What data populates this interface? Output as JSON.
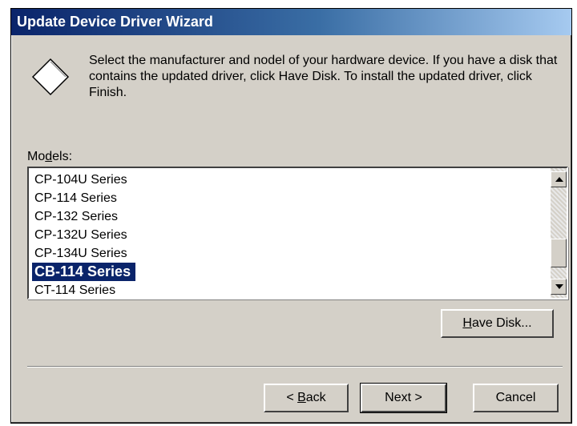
{
  "window": {
    "title": "Update Device Driver Wizard"
  },
  "instructions": "Select the manufacturer and nodel of your hardware device. If you have a disk that contains the updated driver, click Have Disk. To install the updated driver, click Finish.",
  "models": {
    "label_prefix": "Mo",
    "label_accel": "d",
    "label_suffix": "els:",
    "items": [
      "CP-104U Series",
      "CP-114 Series",
      "CP-132 Series",
      "CP-132U Series",
      "CP-134U Series",
      "CB-114 Series",
      "CT-114 Series"
    ],
    "selected": "CB-114 Series"
  },
  "buttons": {
    "have_disk_accel": "H",
    "have_disk_rest": "ave Disk...",
    "back_prefix": "< ",
    "back_accel": "B",
    "back_rest": "ack",
    "next": "Next >",
    "cancel": "Cancel"
  },
  "colors": {
    "title_start": "#0a246a",
    "title_end": "#a6caf0",
    "selection": "#0a246a",
    "face": "#d4d0c8"
  },
  "icons": {
    "wizard": "diamond-icon",
    "scroll_up": "scroll-up-arrow-icon",
    "scroll_down": "scroll-down-arrow-icon"
  }
}
